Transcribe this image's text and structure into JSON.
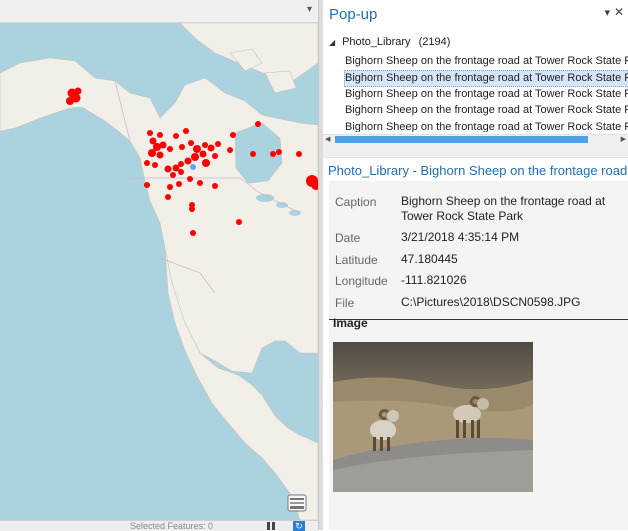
{
  "map": {
    "chevron": "▾",
    "status_text": "Selected Features: 0",
    "colors": {
      "water": "#aad3df",
      "land": "#f2efe9",
      "feature": "#ff0000",
      "highlight": "#5fa8e8"
    }
  },
  "popup": {
    "title": "Pop-up",
    "pin_icon": "pin-icon",
    "close_icon": "close-icon",
    "layer": {
      "name": "Photo_Library",
      "count": "(2194)"
    },
    "features": [
      "Bighorn Sheep on the frontage road at Tower Rock State Park",
      "Bighorn Sheep on the frontage road at Tower Rock State Park",
      "Bighorn Sheep on the frontage road at Tower Rock State Park",
      "Bighorn Sheep on the frontage road at Tower Rock State Park",
      "Bighorn Sheep on the frontage road at Tower Rock State Park"
    ],
    "selected_index": 1,
    "details_title": "Photo_Library - Bighorn Sheep on the frontage road at Tower Rock State Park",
    "fields": {
      "caption_label": "Caption",
      "caption_line1": "Bighorn Sheep on the frontage road at",
      "caption_line2": "Tower Rock State Park",
      "date_label": "Date",
      "date_value": "3/21/2018 4:35:14 PM",
      "latitude_label": "Latitude",
      "latitude_value": "47.180445",
      "longitude_label": "Longitude",
      "longitude_value": "-111.821026",
      "file_label": "File",
      "file_value": "C:\\Pictures\\2018\\DSCN0598.JPG"
    },
    "image_label": "Image"
  }
}
